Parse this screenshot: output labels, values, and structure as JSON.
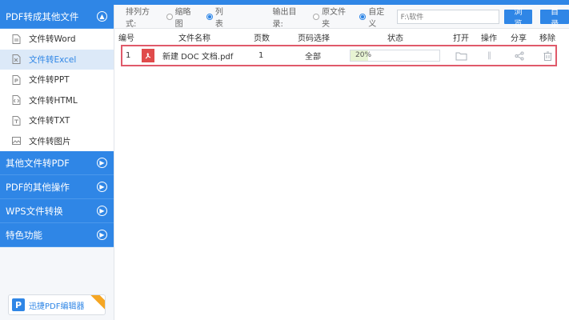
{
  "sidebar": {
    "categories": [
      {
        "label": "PDF转成其他文件"
      },
      {
        "label": "其他文件转PDF"
      },
      {
        "label": "PDF的其他操作"
      },
      {
        "label": "WPS文件转换"
      },
      {
        "label": "特色功能"
      }
    ],
    "items": [
      {
        "label": "文件转Word"
      },
      {
        "label": "文件转Excel"
      },
      {
        "label": "文件转PPT"
      },
      {
        "label": "文件转HTML"
      },
      {
        "label": "文件转TXT"
      },
      {
        "label": "文件转图片"
      }
    ],
    "promo_label": "迅捷PDF编辑器"
  },
  "toolbar": {
    "sort_label": "排列方式:",
    "thumb_label": "缩略图",
    "list_label": "列表",
    "output_label": "输出目录:",
    "orig_folder_label": "原文件夹",
    "custom_label": "自定义",
    "path_value": "F:\\软件",
    "browse_label": "浏览",
    "dir_label": "目录"
  },
  "table": {
    "headers": [
      "编号",
      "文件名称",
      "页数",
      "页码选择",
      "状态",
      "打开",
      "操作",
      "分享",
      "移除"
    ],
    "rows": [
      {
        "no": "1",
        "name": "新建 DOC 文档.pdf",
        "pages": "1",
        "range": "全部",
        "progress_text": "20%",
        "progress": 0.2
      }
    ]
  },
  "colors": {
    "accent": "#2f86e6",
    "row_border": "#e05a6a",
    "pdf_red": "#e04b4b"
  }
}
